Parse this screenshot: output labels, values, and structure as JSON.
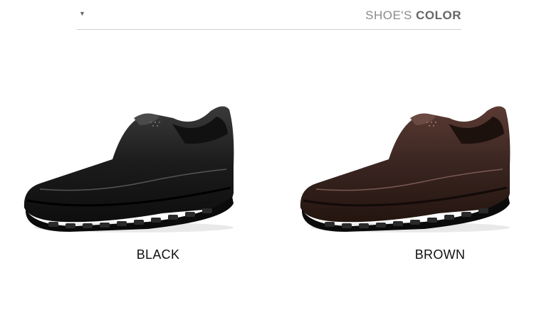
{
  "header": {
    "marker_icon": "triangle-down-icon",
    "title_prefix": "SHOE'S",
    "title_bold": "COLOR"
  },
  "products": [
    {
      "label": "BLACK",
      "color": "#1b1b1b"
    },
    {
      "label": "BROWN",
      "color": "#3a2521"
    }
  ]
}
